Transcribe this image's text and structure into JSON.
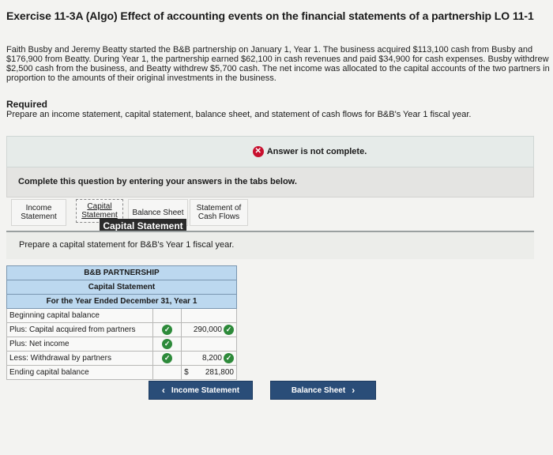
{
  "header": {
    "title": "Exercise 11-3A (Algo) Effect of accounting events on the financial statements of a partnership LO 11-1"
  },
  "problem": {
    "text": "Faith Busby and Jeremy Beatty started the B&B partnership on January 1, Year 1. The business acquired $113,100 cash from Busby and $176,900 from Beatty. During Year 1, the partnership earned $62,100 in cash revenues and paid $34,900 for cash expenses. Busby withdrew $2,500 cash from the business, and Beatty withdrew $5,700 cash. The net income was allocated to the capital accounts of the two partners in proportion to the amounts of their original investments in the business."
  },
  "required": {
    "heading": "Required",
    "text": "Prepare an income statement, capital statement, balance sheet, and statement of cash flows for B&B's Year 1 fiscal year."
  },
  "status": {
    "message": "Answer is not complete."
  },
  "instructions": {
    "text": "Complete this question by entering your answers in the tabs below."
  },
  "tabs": [
    {
      "label_line1": "Income",
      "label_line2": "Statement"
    },
    {
      "label_line1": "Capital",
      "label_line2": "Statement"
    },
    {
      "label_line1": "Balance Sheet",
      "label_line2": ""
    },
    {
      "label_line1": "Statement of",
      "label_line2": "Cash Flows"
    }
  ],
  "tooltip": {
    "text": "Capital Statement"
  },
  "prompt": {
    "text": "Prepare a capital statement for B&B's Year 1 fiscal year."
  },
  "statement": {
    "company": "B&B PARTNERSHIP",
    "name": "Capital Statement",
    "period": "For the Year Ended December 31, Year 1",
    "rows": [
      {
        "label": "Beginning capital balance",
        "value": ""
      },
      {
        "label": "Plus: Capital acquired from partners",
        "value": "290,000"
      },
      {
        "label": "Plus: Net income",
        "value": ""
      },
      {
        "label": "Less: Withdrawal by partners",
        "value": "8,200"
      },
      {
        "label": "Ending capital balance",
        "currency": "$",
        "value": "281,800"
      }
    ]
  },
  "nav": {
    "prev_label": "Income Statement",
    "next_label": "Balance Sheet"
  },
  "colors": {
    "header_fill": "#bcd8ef",
    "button": "#2a4d78",
    "error": "#c8102e",
    "correct": "#2d8a3a"
  }
}
